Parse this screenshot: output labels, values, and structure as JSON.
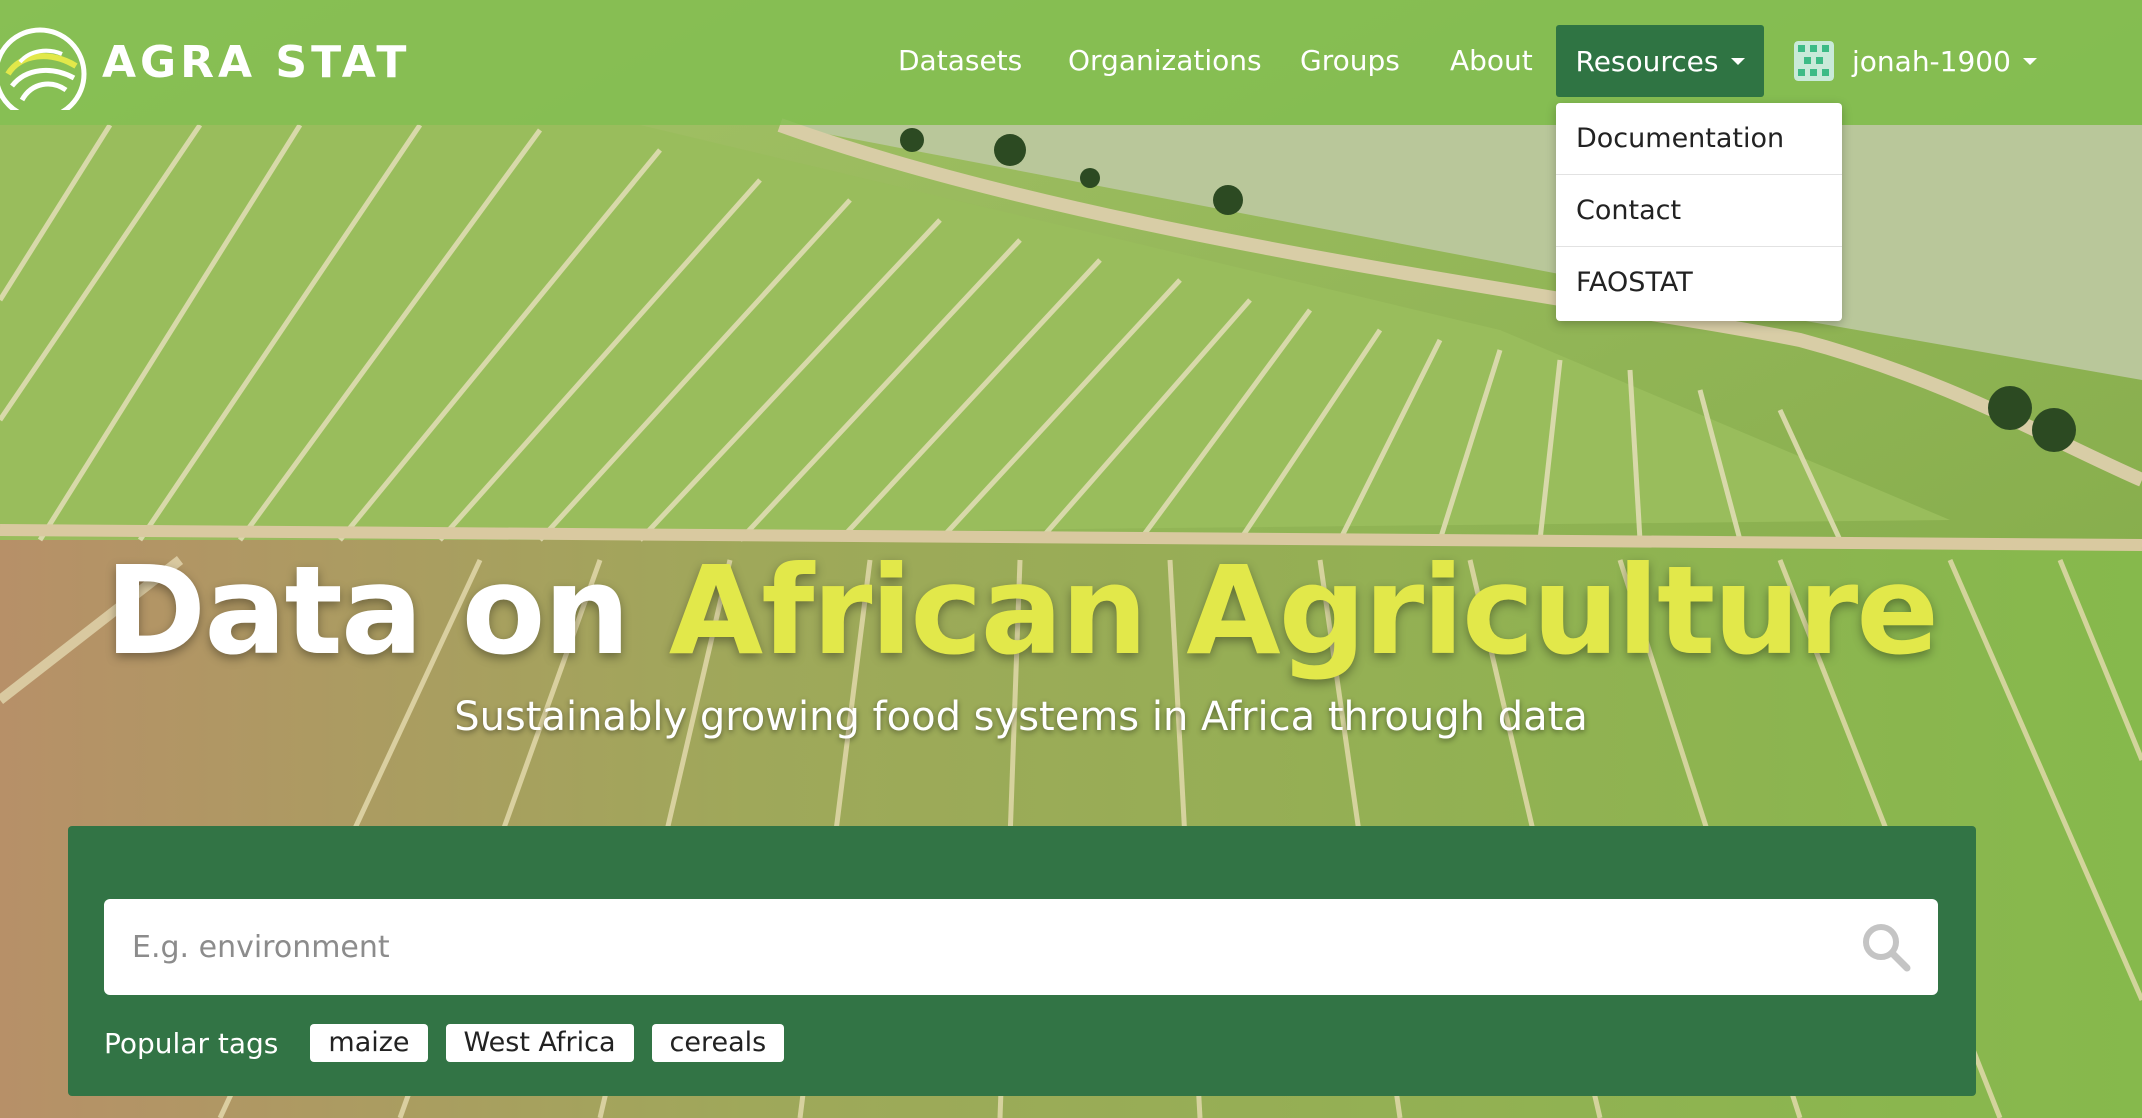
{
  "brand": {
    "name": "AGRA STAT",
    "logo_icon": "agra-leaf-logo"
  },
  "nav": {
    "links": [
      "Datasets",
      "Organizations",
      "Groups",
      "About"
    ],
    "resources_label": "Resources",
    "user_label": "jonah-1900"
  },
  "dropdown": {
    "items": [
      "Documentation",
      "Contact",
      "FAOSTAT"
    ]
  },
  "hero": {
    "title_white": "Data on",
    "title_highlight": "African Agriculture",
    "subtitle": "Sustainably growing food systems in Africa through data"
  },
  "search": {
    "placeholder": "E.g. environment",
    "value": "",
    "icon": "search-icon"
  },
  "popular_tags": {
    "label": "Popular tags",
    "tags": [
      "maize",
      "West Africa",
      "cereals"
    ]
  },
  "colors": {
    "primary_green": "#327445",
    "nav_green": "#82be50",
    "highlight_yellow": "#e2e84a"
  }
}
